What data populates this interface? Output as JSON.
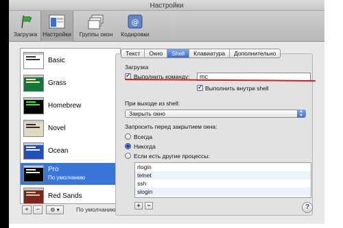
{
  "window": {
    "title": "Настройки"
  },
  "toolbar": {
    "items": [
      {
        "label": "Загрузка",
        "icon": "flag-icon"
      },
      {
        "label": "Настройки",
        "icon": "settings-window-icon"
      },
      {
        "label": "Группы окон",
        "icon": "window-groups-icon"
      },
      {
        "label": "Кодировки",
        "icon": "encodings-icon"
      }
    ],
    "selected": "Настройки"
  },
  "sidebar": {
    "profiles": [
      {
        "name": "Basic",
        "thumb_bg": "#ffffff",
        "thumb_fg": "#333333"
      },
      {
        "name": "Grass",
        "thumb_bg": "#13773d",
        "thumb_fg": "#fff0a5"
      },
      {
        "name": "Homebrew",
        "thumb_bg": "#000000",
        "thumb_fg": "#28fe14"
      },
      {
        "name": "Novel",
        "thumb_bg": "#dfdbc3",
        "thumb_fg": "#3b2322"
      },
      {
        "name": "Ocean",
        "thumb_bg": "#224fbc",
        "thumb_fg": "#ffffff"
      },
      {
        "name": "Pro",
        "subtitle": "По умолчанию",
        "thumb_bg": "#000000",
        "thumb_fg": "#f2f2f2",
        "selected": true
      },
      {
        "name": "Red Sands",
        "thumb_bg": "#7a251e",
        "thumb_fg": "#d7c9a7"
      }
    ],
    "add": "+",
    "remove": "−",
    "gear": "⚙ ▾",
    "default_label": "По умолчанию"
  },
  "tabs": [
    "Текст",
    "Окно",
    "Shell",
    "Клавиатура",
    "Дополнительно"
  ],
  "selected_tab": "Shell",
  "startup": {
    "heading": "Загрузка",
    "run_command_label": "Выполнить команду:",
    "run_command_checked": true,
    "command_value": "mc",
    "run_in_shell_label": "Выполнить внутри shell",
    "run_in_shell_checked": true
  },
  "on_exit": {
    "heading": "При выходе из shell:",
    "selected": "Закрыть окно"
  },
  "prompt": {
    "heading": "Запросить перед закрытием окна:",
    "options": [
      "Всегда",
      "Никогда",
      "Если есть другие процессы:"
    ],
    "selected": "Никогда",
    "processes": [
      "rlogin",
      "telnet",
      "ssh",
      "slogin"
    ],
    "add": "+",
    "remove": "−"
  },
  "help": "?",
  "colors": {
    "selection": "#3876d8",
    "annotation_line": "#d42020"
  }
}
